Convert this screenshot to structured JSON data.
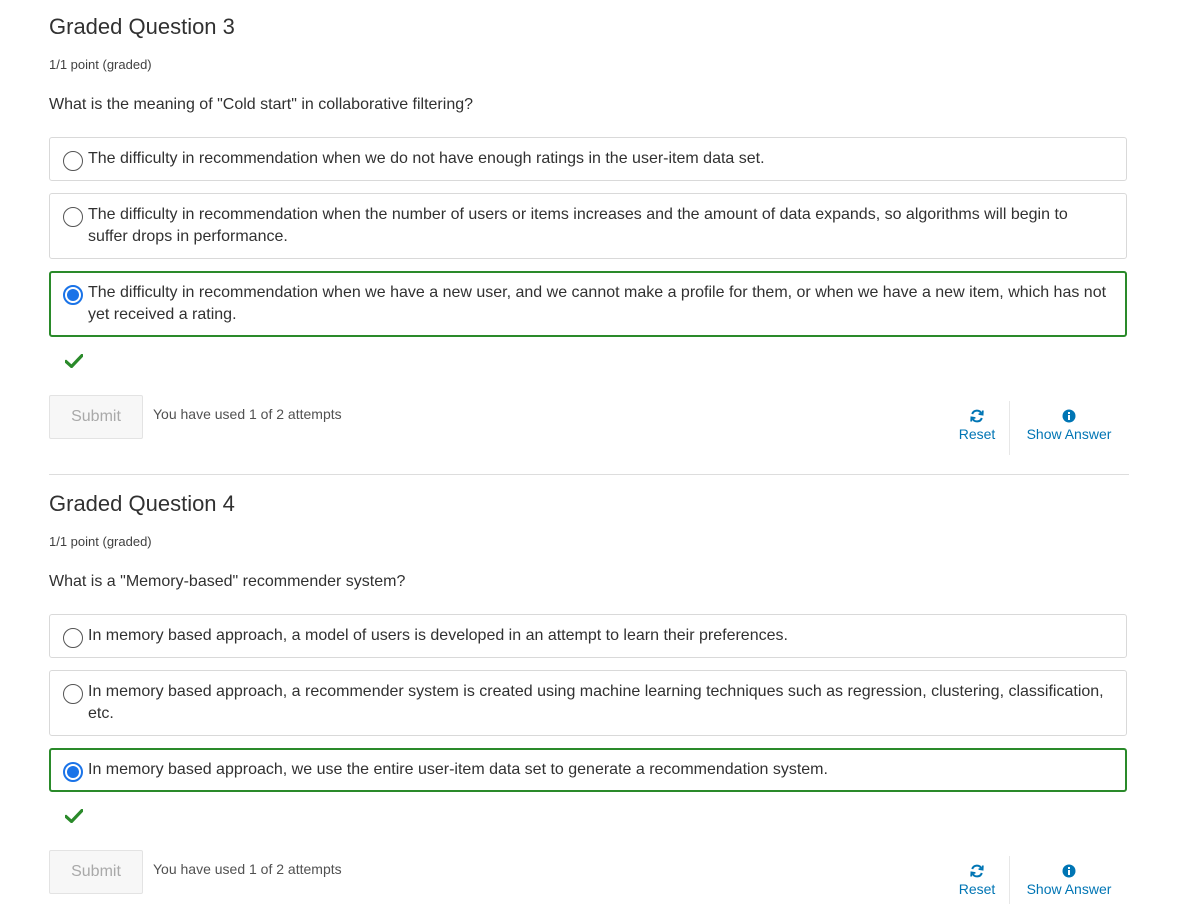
{
  "questions": [
    {
      "title": "Graded Question 3",
      "points": "1/1 point (graded)",
      "prompt": "What is the meaning of \"Cold start\" in collaborative filtering?",
      "choices": [
        {
          "label": "The difficulty in recommendation when we do not have enough ratings in the user-item data set.",
          "selected": false
        },
        {
          "label": "The difficulty in recommendation when the number of users or items increases and the amount of data expands, so algorithms will begin to suffer drops in performance.",
          "selected": false
        },
        {
          "label": "The difficulty in recommendation when we have a new user, and we cannot make a profile for them, or when we have a new item, which has not yet received a rating.",
          "selected": true
        }
      ],
      "status_icon": "checkmark-icon",
      "submit_label": "Submit",
      "attempts_text": "You have used 1 of 2 attempts",
      "reset_label": "Reset",
      "show_answer_label": "Show Answer"
    },
    {
      "title": "Graded Question 4",
      "points": "1/1 point (graded)",
      "prompt": "What is a \"Memory-based\" recommender system?",
      "choices": [
        {
          "label": "In memory based approach, a model of users is developed in an attempt to learn their preferences.",
          "selected": false
        },
        {
          "label": "In memory based approach, a recommender system is created using machine learning techniques such as regression, clustering, classification, etc.",
          "selected": false
        },
        {
          "label": "In memory based approach, we use the entire user-item data set to generate a recommendation system.",
          "selected": true
        }
      ],
      "status_icon": "checkmark-icon",
      "submit_label": "Submit",
      "attempts_text": "You have used 1 of 2 attempts",
      "reset_label": "Reset",
      "show_answer_label": "Show Answer"
    }
  ],
  "colors": {
    "correct": "#2a8a2a",
    "radio_selected": "#1a73e8",
    "link": "#0075b4"
  }
}
